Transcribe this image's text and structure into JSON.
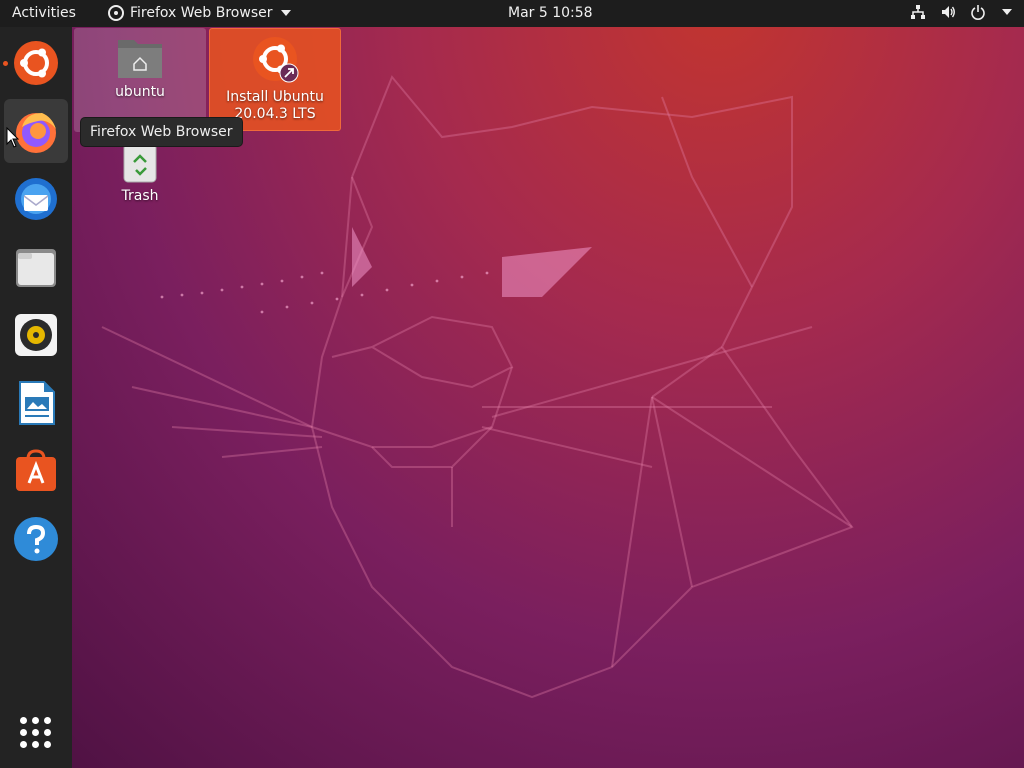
{
  "topbar": {
    "activities": "Activities",
    "app_menu": "Firefox Web Browser",
    "clock": "Mar 5  10:58"
  },
  "dock": {
    "items": [
      {
        "name": "Install Ubuntu",
        "icon": "ubuntu-installer-icon"
      },
      {
        "name": "Firefox Web Browser",
        "icon": "firefox-icon",
        "active": true
      },
      {
        "name": "Thunderbird Mail",
        "icon": "thunderbird-icon"
      },
      {
        "name": "Files",
        "icon": "files-icon"
      },
      {
        "name": "Rhythmbox",
        "icon": "rhythmbox-icon"
      },
      {
        "name": "LibreOffice Writer",
        "icon": "writer-icon"
      },
      {
        "name": "Ubuntu Software",
        "icon": "software-icon"
      },
      {
        "name": "Help",
        "icon": "help-icon"
      }
    ],
    "show_apps_icon": "app-grid-icon"
  },
  "desktop": {
    "home_label": "ubuntu",
    "install_label_line1": "Install Ubuntu",
    "install_label_line2": "20.04.3 LTS",
    "trash_label": "Trash"
  },
  "tooltip": "Firefox Web Browser",
  "colors": {
    "accent": "#e95420",
    "topbar": "#1d1d1d",
    "dock": "#232323"
  }
}
